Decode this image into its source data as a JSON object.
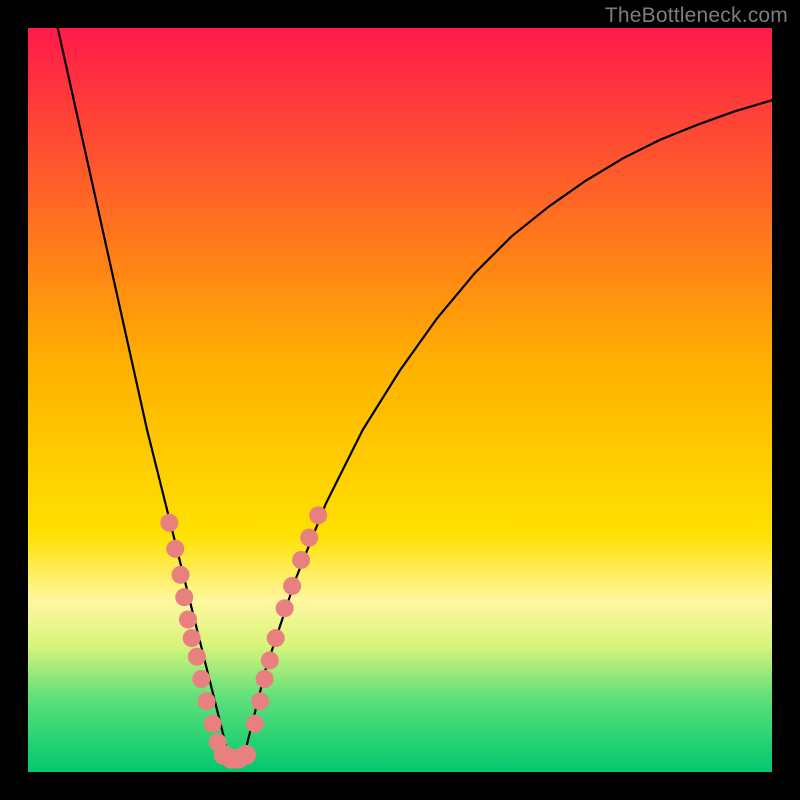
{
  "watermark": "TheBottleneck.com",
  "chart_data": {
    "type": "line",
    "title": "",
    "xlabel": "",
    "ylabel": "",
    "xlim": [
      0,
      100
    ],
    "ylim": [
      0,
      100
    ],
    "grid": false,
    "background_gradient": {
      "stops": [
        {
          "offset": 0,
          "color": "#ff1a4b"
        },
        {
          "offset": 45,
          "color": "#ffb000"
        },
        {
          "offset": 68,
          "color": "#ffe100"
        },
        {
          "offset": 77,
          "color": "#fff7a0"
        },
        {
          "offset": 83,
          "color": "#d8f47a"
        },
        {
          "offset": 90,
          "color": "#5ee07a"
        },
        {
          "offset": 100,
          "color": "#00c86e"
        }
      ]
    },
    "series": [
      {
        "name": "left-branch",
        "color": "#000000",
        "stroke_width": 2.2,
        "x": [
          4,
          6,
          8,
          10,
          12,
          14,
          16,
          18,
          20,
          21,
          22,
          23,
          24,
          25,
          26,
          27
        ],
        "y": [
          100,
          91,
          82,
          73,
          64,
          55,
          46,
          38,
          30,
          26,
          22,
          18,
          14,
          10,
          6,
          2
        ]
      },
      {
        "name": "right-branch",
        "color": "#000000",
        "stroke_width": 2.2,
        "x": [
          29,
          30,
          31,
          32,
          34,
          36,
          40,
          45,
          50,
          55,
          60,
          65,
          70,
          75,
          80,
          85,
          90,
          95,
          100
        ],
        "y": [
          2,
          6,
          10,
          14,
          20,
          26,
          36,
          46,
          54,
          61,
          67,
          72,
          76,
          79.5,
          82.5,
          85,
          87,
          88.8,
          90.3
        ]
      },
      {
        "name": "valley-bottom",
        "color": "#000000",
        "stroke_width": 2.2,
        "x": [
          27,
          28,
          29
        ],
        "y": [
          2,
          1.2,
          2
        ]
      }
    ],
    "markers": [
      {
        "name": "dots-left",
        "color": "#e98080",
        "radius": 9,
        "points": [
          {
            "x": 19.0,
            "y": 33.5
          },
          {
            "x": 19.8,
            "y": 30.0
          },
          {
            "x": 20.5,
            "y": 26.5
          },
          {
            "x": 21.0,
            "y": 23.5
          },
          {
            "x": 21.5,
            "y": 20.5
          },
          {
            "x": 22.0,
            "y": 18.0
          },
          {
            "x": 22.7,
            "y": 15.5
          },
          {
            "x": 23.3,
            "y": 12.5
          },
          {
            "x": 24.0,
            "y": 9.5
          },
          {
            "x": 24.8,
            "y": 6.5
          },
          {
            "x": 25.5,
            "y": 4.0
          }
        ]
      },
      {
        "name": "dots-right",
        "color": "#e98080",
        "radius": 9,
        "points": [
          {
            "x": 30.5,
            "y": 6.5
          },
          {
            "x": 31.2,
            "y": 9.5
          },
          {
            "x": 31.8,
            "y": 12.5
          },
          {
            "x": 32.5,
            "y": 15.0
          },
          {
            "x": 33.3,
            "y": 18.0
          },
          {
            "x": 34.5,
            "y": 22.0
          },
          {
            "x": 35.5,
            "y": 25.0
          },
          {
            "x": 36.7,
            "y": 28.5
          },
          {
            "x": 37.8,
            "y": 31.5
          },
          {
            "x": 39.0,
            "y": 34.5
          }
        ]
      },
      {
        "name": "dots-bottom",
        "color": "#e98080",
        "radius": 10,
        "points": [
          {
            "x": 26.3,
            "y": 2.3
          },
          {
            "x": 27.3,
            "y": 1.8
          },
          {
            "x": 28.3,
            "y": 1.8
          },
          {
            "x": 29.3,
            "y": 2.3
          }
        ]
      }
    ]
  }
}
